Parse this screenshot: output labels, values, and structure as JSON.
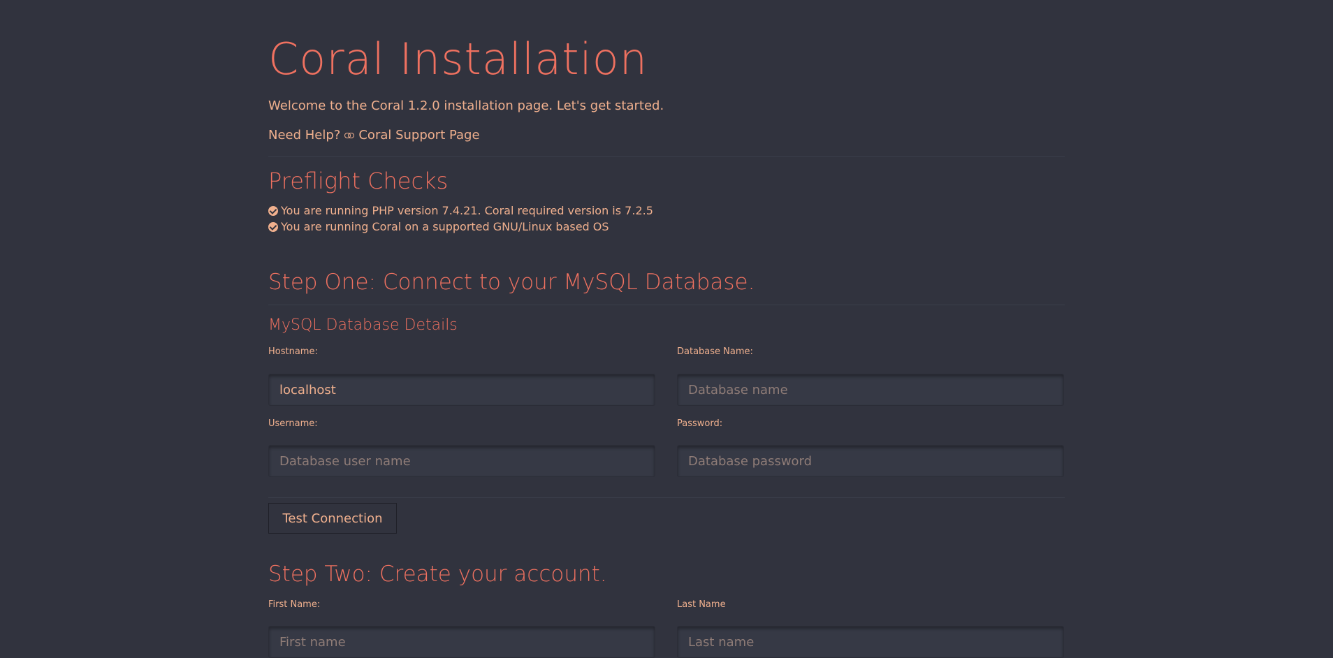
{
  "header": {
    "title": "Coral Installation",
    "welcome": "Welcome to the Coral 1.2.0 installation page. Let's get started.",
    "help_prefix": "Need Help?",
    "help_link_label": "Coral Support Page"
  },
  "preflight": {
    "heading": "Preflight Checks",
    "checks": [
      "You are running PHP version 7.4.21. Coral required version is 7.2.5",
      "You are running Coral on a supported GNU/Linux based OS"
    ]
  },
  "step_one": {
    "heading": "Step One: Connect to your MySQL Database.",
    "subheading": "MySQL Database Details",
    "hostname_label": "Hostname:",
    "hostname_value": "localhost",
    "dbname_label": "Database Name:",
    "dbname_placeholder": "Database name",
    "username_label": "Username:",
    "username_placeholder": "Database user name",
    "password_label": "Password:",
    "password_placeholder": "Database password",
    "test_button": "Test Connection"
  },
  "step_two": {
    "heading": "Step Two: Create your account.",
    "firstname_label": "First Name:",
    "firstname_placeholder": "First name",
    "lastname_label": "Last Name",
    "lastname_placeholder": "Last name"
  },
  "colors": {
    "background": "#31333e",
    "heading": "#ef7160",
    "text": "#f0b08e"
  },
  "icons": {
    "help_link": "link-icon",
    "check": "check-circle-icon"
  }
}
